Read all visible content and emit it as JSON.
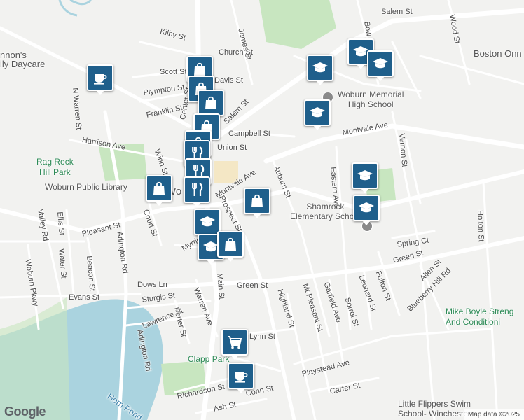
{
  "map": {
    "attribution": "Map data ©2025",
    "logo": "Google"
  },
  "streets": [
    {
      "name": "Salem St"
    },
    {
      "name": "Wood St"
    },
    {
      "name": "Bow St"
    },
    {
      "name": "Kilby St"
    },
    {
      "name": "James St"
    },
    {
      "name": "Scott St"
    },
    {
      "name": "Plympton St"
    },
    {
      "name": "Franklin St"
    },
    {
      "name": "Salem St"
    },
    {
      "name": "Campbell St"
    },
    {
      "name": "Montvale Ave"
    },
    {
      "name": "Harrison Ave"
    },
    {
      "name": "Winn St"
    },
    {
      "name": "Montvale Ave"
    },
    {
      "name": "Prospect St"
    },
    {
      "name": "Auburn St"
    },
    {
      "name": "Eastern Ave"
    },
    {
      "name": "Vernon St"
    },
    {
      "name": "Holton St"
    },
    {
      "name": "N Warren St"
    },
    {
      "name": "Pleasant St"
    },
    {
      "name": "Court St"
    },
    {
      "name": "Valley Rd"
    },
    {
      "name": "Ellis St"
    },
    {
      "name": "Water St"
    },
    {
      "name": "Beacon St"
    },
    {
      "name": "Woburn Pkwy"
    },
    {
      "name": "Arlington Rd"
    },
    {
      "name": "Myrtle St"
    },
    {
      "name": "Spring Ct"
    },
    {
      "name": "Green St"
    },
    {
      "name": "Green St"
    },
    {
      "name": "Allen St"
    },
    {
      "name": "Fulton St"
    },
    {
      "name": "Leonard St"
    },
    {
      "name": "Blueberry Hill Rd"
    },
    {
      "name": "Dows Ln"
    },
    {
      "name": "Evans St"
    },
    {
      "name": "Sturgis St"
    },
    {
      "name": "Main St"
    },
    {
      "name": "Highland St"
    },
    {
      "name": "Mt Pleasant St"
    },
    {
      "name": "Garfield Ave"
    },
    {
      "name": "Sorrel St"
    },
    {
      "name": "Lawrence St"
    },
    {
      "name": "Porter St"
    },
    {
      "name": "Warren Ave"
    },
    {
      "name": "Arlington Rd"
    },
    {
      "name": "Playstead Ave"
    },
    {
      "name": "Carter St"
    },
    {
      "name": "Richardson St"
    },
    {
      "name": "Ash St"
    },
    {
      "name": "Conn St"
    },
    {
      "name": "Lynn St"
    },
    {
      "name": "Center St"
    },
    {
      "name": "Church St"
    },
    {
      "name": "Davis St"
    },
    {
      "name": "Union St"
    }
  ],
  "places": [
    {
      "name": "Boston Onn",
      "type": "business"
    },
    {
      "name": "nnon's\nily Daycare",
      "type": "business"
    },
    {
      "name": "Woburn Memorial\nHigh School",
      "type": "school"
    },
    {
      "name": "Rag Rock\nHill Park",
      "type": "park"
    },
    {
      "name": "Woburn Public Library",
      "type": "library"
    },
    {
      "name": "Shamrock\nElementary School",
      "type": "school"
    },
    {
      "name": "Mike Boyle Streng\nAnd Conditioni",
      "type": "gym"
    },
    {
      "name": "Clapp Park",
      "type": "park"
    },
    {
      "name": "Horn Pond",
      "type": "water"
    },
    {
      "name": "Little Flippers Swim\nSchool- Winchester",
      "type": "business"
    },
    {
      "name": "Wo",
      "type": "city"
    }
  ],
  "markers": [
    {
      "icon": "graduation-cap-icon",
      "category": "school"
    },
    {
      "icon": "graduation-cap-icon",
      "category": "school"
    },
    {
      "icon": "graduation-cap-icon",
      "category": "school"
    },
    {
      "icon": "graduation-cap-icon",
      "category": "school"
    },
    {
      "icon": "graduation-cap-icon",
      "category": "school"
    },
    {
      "icon": "graduation-cap-icon",
      "category": "school"
    },
    {
      "icon": "graduation-cap-icon",
      "category": "school"
    },
    {
      "icon": "graduation-cap-icon",
      "category": "school"
    },
    {
      "icon": "coffee-cup-icon",
      "category": "cafe"
    },
    {
      "icon": "coffee-cup-icon",
      "category": "cafe"
    },
    {
      "icon": "shopping-bag-icon",
      "category": "store"
    },
    {
      "icon": "shopping-bag-icon",
      "category": "store"
    },
    {
      "icon": "shopping-bag-icon",
      "category": "store"
    },
    {
      "icon": "shopping-bag-icon",
      "category": "store"
    },
    {
      "icon": "shopping-bag-icon",
      "category": "store"
    },
    {
      "icon": "shopping-bag-icon",
      "category": "store"
    },
    {
      "icon": "shopping-cart-icon",
      "category": "grocery"
    },
    {
      "icon": "fork-knife-icon",
      "category": "restaurant"
    },
    {
      "icon": "fork-knife-icon",
      "category": "restaurant"
    },
    {
      "icon": "fork-knife-icon",
      "category": "restaurant"
    },
    {
      "icon": "shopping-bag-icon",
      "category": "store"
    },
    {
      "icon": "shopping-bag-icon",
      "category": "store"
    }
  ],
  "colors": {
    "marker": "#1f5f8b",
    "water": "#aad3df",
    "park": "#c8e6c0",
    "road": "#ffffff"
  }
}
